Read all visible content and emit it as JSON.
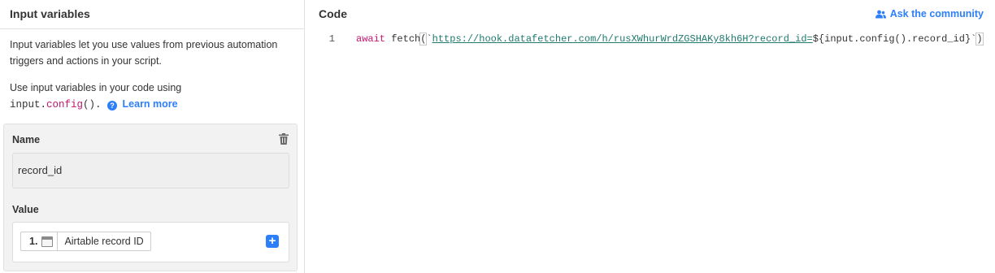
{
  "left_panel": {
    "title": "Input variables",
    "description_1": "Input variables let you use values from previous automation triggers and actions in your script.",
    "description_2_prefix": "Use input variables in your code using",
    "code_input": "input",
    "code_dot": ".",
    "code_config": "config",
    "code_parens": "().",
    "help_glyph": "?",
    "learn_more": "Learn more",
    "variable": {
      "name_label": "Name",
      "name_value": "record_id",
      "value_label": "Value",
      "token_step": "1.",
      "token_icon": "table-icon",
      "token_label": "Airtable record ID",
      "add_glyph": "+"
    }
  },
  "right_panel": {
    "title": "Code",
    "community_link": "Ask the community",
    "lines": [
      {
        "number": "1",
        "keyword": "await",
        "fn": " fetch",
        "open_paren": "(",
        "backtick_open": "`",
        "url": "https://hook.datafetcher.com/h/rusXWhurWrdZGSHAKy8kh6H?record_id=",
        "interp": "${input.config().record_id}",
        "backtick_close": "`",
        "close_paren": ")"
      }
    ]
  },
  "colors": {
    "accent": "#2d7ff9",
    "keyword": "#c4146e",
    "url": "#1f7a6f"
  }
}
